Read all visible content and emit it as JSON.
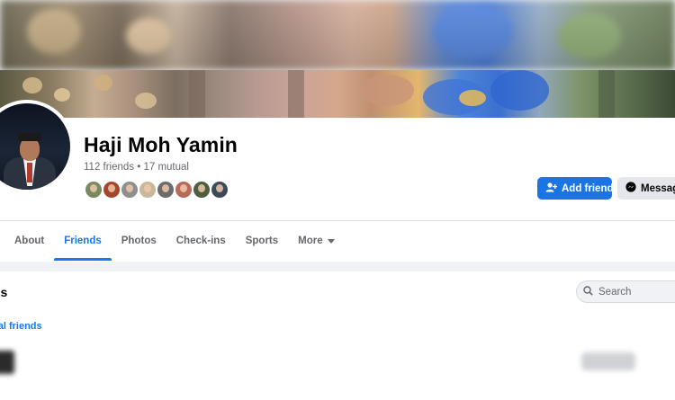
{
  "profile": {
    "name": "Haji Moh Yamin",
    "friends_text": "112 friends • 17 mutual",
    "mutual_avatar_colors": [
      "#7b8a5e",
      "#a3472e",
      "#8f8f8f",
      "#c9b89b",
      "#6b6b6b",
      "#b86b5c",
      "#4e5d3f",
      "#3d4a5c"
    ]
  },
  "actions": {
    "add_friend_label": "Add friend",
    "message_label": "Message"
  },
  "tabs": [
    {
      "label": "About",
      "active": false
    },
    {
      "label": "Friends",
      "active": true
    },
    {
      "label": "Photos",
      "active": false
    },
    {
      "label": "Check-ins",
      "active": false
    },
    {
      "label": "Sports",
      "active": false
    },
    {
      "label": "More",
      "active": false
    }
  ],
  "friends_section": {
    "title": "ds",
    "search_placeholder": "Search",
    "subtab_label": "ual friends"
  },
  "colors": {
    "accent": "#1877f2",
    "button_primary": "#1b74e4",
    "text_primary": "#050505",
    "text_secondary": "#65676b"
  }
}
